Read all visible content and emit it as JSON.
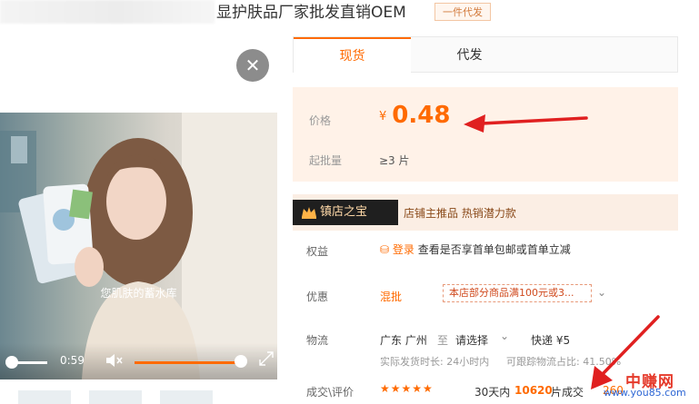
{
  "title": {
    "text": "显护肤品厂家批发直销OEM",
    "badge": "一件代发"
  },
  "video": {
    "caption": "您肌肤的蓄水库",
    "time": "0:59",
    "progress_fraction": 0.0,
    "volume_fraction": 0.9
  },
  "tabs": [
    {
      "label": "现货",
      "active": true
    },
    {
      "label": "代发",
      "active": false
    }
  ],
  "price": {
    "label": "价格",
    "currency": "¥",
    "value": "0.48",
    "moq_label": "起批量",
    "moq_value": "≥3 片"
  },
  "shop": {
    "badge": "镇店之宝",
    "text": "店铺主推品 热销潜力款"
  },
  "benefit": {
    "label": "权益",
    "login": "登录",
    "text": "查看是否享首单包邮或首单立减"
  },
  "promo": {
    "label": "优惠",
    "type": "混批",
    "coupon": "本店部分商品满100元或3..."
  },
  "logistics": {
    "label": "物流",
    "from": "广东 广州",
    "to_word": "至",
    "select": "请选择",
    "ship": "快递 ¥5",
    "meta1": "实际发货时长: 24小时内",
    "meta2": "可跟踪物流占比: 41.50%"
  },
  "deals": {
    "label": "成交\\评价",
    "stars": "★★★★★",
    "days": "30天内",
    "count": "10620",
    "unit": "片成交",
    "partial": "260"
  },
  "watermark": {
    "big": "中赚网",
    "small": "www.you85.com"
  },
  "colors": {
    "accent": "#ff6a00",
    "arrow": "#e02020"
  }
}
